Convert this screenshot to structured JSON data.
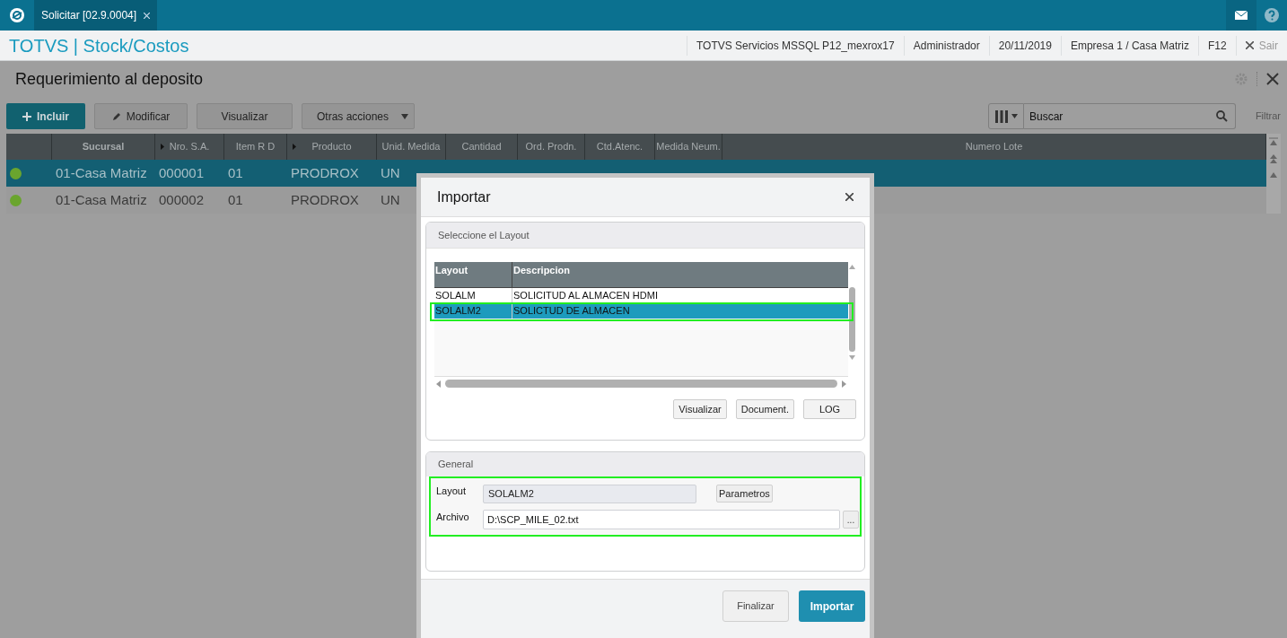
{
  "top_bar": {
    "tab": {
      "label": "Solicitar [02.9.0004]",
      "selected": true
    }
  },
  "header": {
    "app_title": "TOTVS | Stock/Costos",
    "info": [
      "TOTVS Servicios MSSQL P12_mexrox17",
      "Administrador",
      "20/11/2019",
      "Empresa 1 / Casa Matriz",
      "F12"
    ],
    "exit": "Sair"
  },
  "page": {
    "title": "Requerimiento al deposito",
    "toolbar": [
      {
        "label": "Incluir",
        "kind": "primary"
      },
      {
        "label": "Modificar",
        "kind": "edit"
      },
      {
        "label": "Visualizar",
        "kind": "plain"
      },
      {
        "label": "Otras acciones",
        "kind": "menu"
      }
    ],
    "search": {
      "placeholder": "Buscar"
    },
    "filter": "Filtrar",
    "table": {
      "columns": [
        {
          "label": "Sucursal",
          "sortable": false
        },
        {
          "label": "Nro. S.A.",
          "sortable": true
        },
        {
          "label": "Item R D",
          "sortable": false
        },
        {
          "label": "Producto",
          "sortable": true
        },
        {
          "label": "Unid. Medida",
          "sortable": false
        },
        {
          "label": "Cantidad",
          "sortable": false
        },
        {
          "label": "Ord. Prodn.",
          "sortable": false
        },
        {
          "label": "Ctd.Atenc.",
          "sortable": false
        },
        {
          "label": "Medida Neum.",
          "sortable": false
        },
        {
          "label": "Numero Lote",
          "sortable": false
        }
      ],
      "rows": [
        {
          "selected": true,
          "color": "#6aa52e",
          "cells": [
            "01-Casa Matriz",
            "000001",
            "01",
            "PRODROX",
            "UN",
            "",
            "",
            "",
            "",
            ""
          ]
        },
        {
          "selected": false,
          "color": "#6aa52e",
          "cells": [
            "01-Casa Matriz",
            "000002",
            "01",
            "PRODROX",
            "UN",
            "",
            "",
            "",
            "",
            ""
          ]
        }
      ]
    }
  },
  "dialog": {
    "title": "Importar",
    "layout_section": {
      "title": "Seleccione el Layout",
      "columns": [
        "Layout",
        "Descripcion"
      ],
      "rows": [
        {
          "selected": false,
          "highlighted": false,
          "cells": [
            "SOLALM",
            "SOLICITUD AL ALMACEN HDMI"
          ]
        },
        {
          "selected": true,
          "highlighted": true,
          "cells": [
            "SOLALM2",
            "SOLICTUD DE ALMACEN"
          ]
        }
      ],
      "buttons": [
        "Visualizar",
        "Document.",
        "LOG"
      ]
    },
    "general_section": {
      "title": "General",
      "highlighted": true,
      "layout_label": "Layout",
      "layout_value": "SOLALM2",
      "parameters_button": "Parametros",
      "file_label": "Archivo",
      "file_value": "D:\\SCP_MILE_02.txt",
      "browse_button": "..."
    },
    "buttons": [
      {
        "label": "Finalizar",
        "kind": "secondary"
      },
      {
        "label": "Importar",
        "kind": "primary"
      }
    ]
  }
}
